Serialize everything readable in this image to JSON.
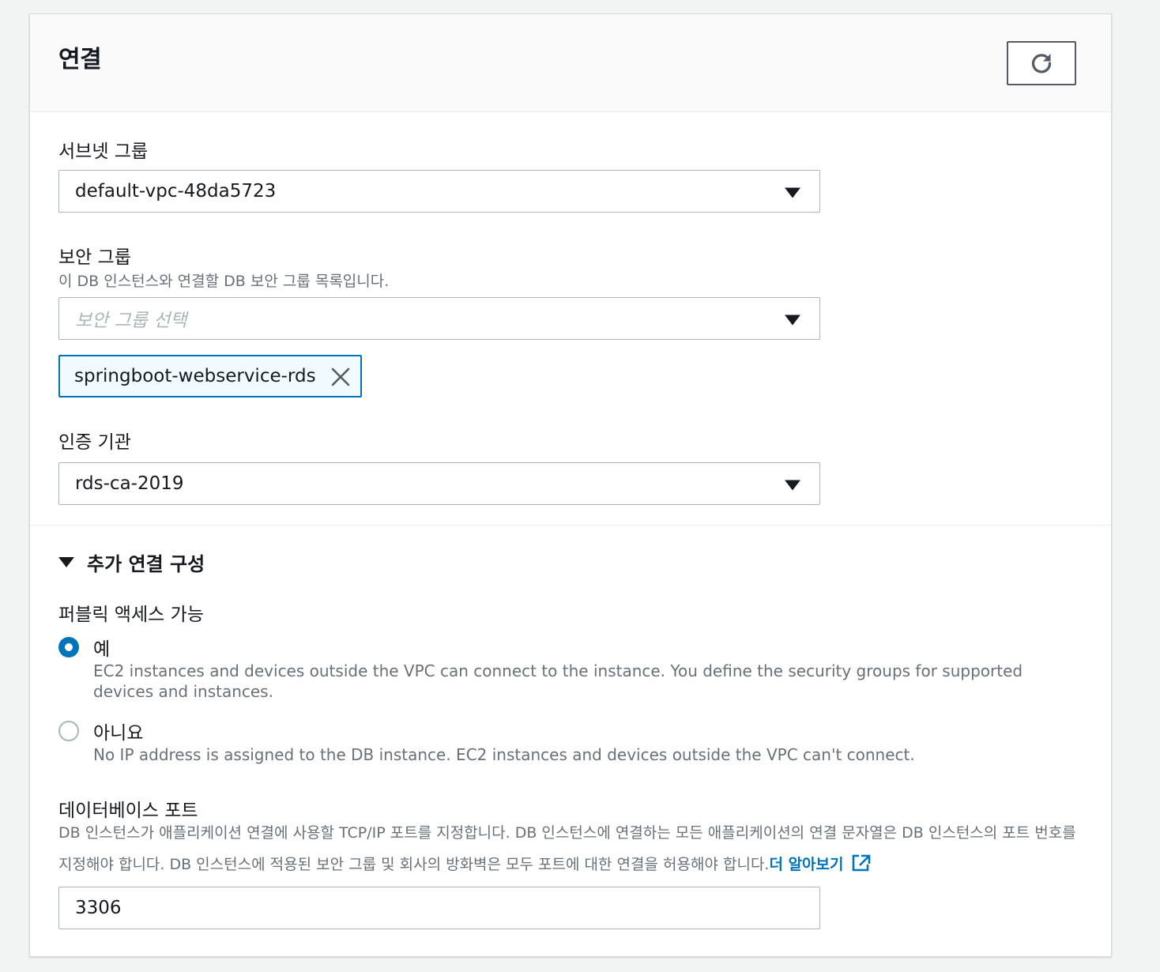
{
  "section": {
    "title": "연결",
    "refresh_icon": "refresh-icon"
  },
  "subnet_group": {
    "label": "서브넷 그룹",
    "value": "default-vpc-48da5723"
  },
  "security_group": {
    "label": "보안 그룹",
    "description": "이 DB 인스턴스와 연결할 DB 보안 그룹 목록입니다.",
    "placeholder": "보안 그룹 선택",
    "selected_token": "springboot-webservice-rds"
  },
  "certificate_authority": {
    "label": "인증 기관",
    "value": "rds-ca-2019"
  },
  "additional": {
    "label": "추가 연결 구성",
    "expanded": true
  },
  "public_access": {
    "label": "퍼블릭 액세스 가능",
    "options": [
      {
        "label": "예",
        "description": "EC2 instances and devices outside the VPC can connect to the instance. You define the security groups for supported devices and instances.",
        "checked": true
      },
      {
        "label": "아니요",
        "description": "No IP address is assigned to the DB instance. EC2 instances and devices outside the VPC can't connect.",
        "checked": false
      }
    ]
  },
  "database_port": {
    "label": "데이터베이스 포트",
    "description": "DB 인스턴스가 애플리케이션 연결에 사용할 TCP/IP 포트를 지정합니다. DB 인스턴스에 연결하는 모든 애플리케이션의 연결 문자열은 DB 인스턴스의 포트 번호를 지정해야 합니다. DB 인스턴스에 적용된 보안 그룹 및 회사의 방화벽은 모두 포트에 대한 연결을 허용해야 합니다.",
    "learn_more": "더 알아보기",
    "value": "3306"
  },
  "colors": {
    "accent": "#0073bb",
    "text": "#16191f",
    "secondary_text": "#687078",
    "border": "#aab7b8",
    "header_bg": "#fafafa"
  }
}
